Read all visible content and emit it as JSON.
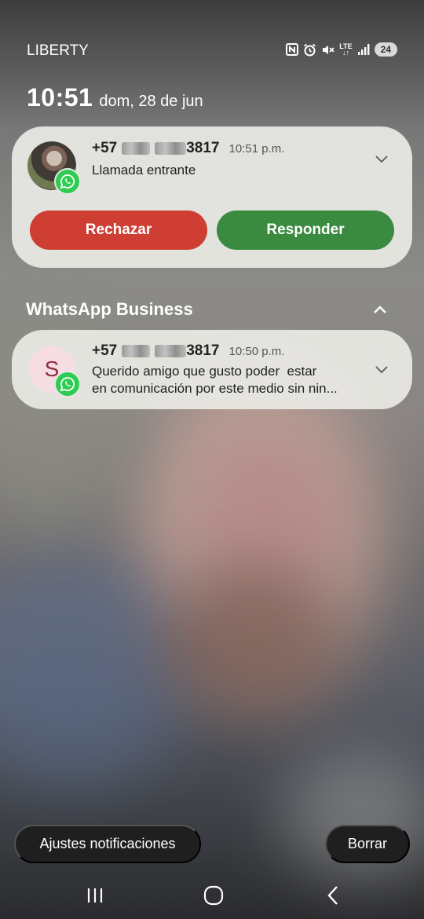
{
  "status_bar": {
    "carrier": "LIBERTY",
    "network": "LTE",
    "battery_level": "24",
    "icons": [
      "nfc-icon",
      "alarm-icon",
      "mute-icon",
      "lte-icon",
      "signal-icon",
      "battery-icon"
    ]
  },
  "lockscreen": {
    "time": "10:51",
    "date": "dom, 28 de jun"
  },
  "call_notification": {
    "number_prefix": "+57",
    "number_suffix": "3817",
    "time": "10:51 p.m.",
    "text": "Llamada entrante",
    "reject_label": "Rechazar",
    "answer_label": "Responder",
    "reject_color": "#cf3e32",
    "answer_color": "#3a8a40"
  },
  "group": {
    "title": "WhatsApp Business"
  },
  "message_notification": {
    "avatar_letter": "S",
    "number_prefix": "+57",
    "number_suffix": "3817",
    "time": "10:50 p.m.",
    "text_line1": "Querido amigo que gusto poder  estar",
    "text_line2": "en comunicación por este medio sin nin..."
  },
  "actions": {
    "settings_label": "Ajustes notificaciones",
    "clear_label": "Borrar"
  },
  "navigation": {
    "icons": [
      "recents-icon",
      "home-icon",
      "back-icon"
    ]
  },
  "colors": {
    "whatsapp_green": "#2ecc52"
  }
}
